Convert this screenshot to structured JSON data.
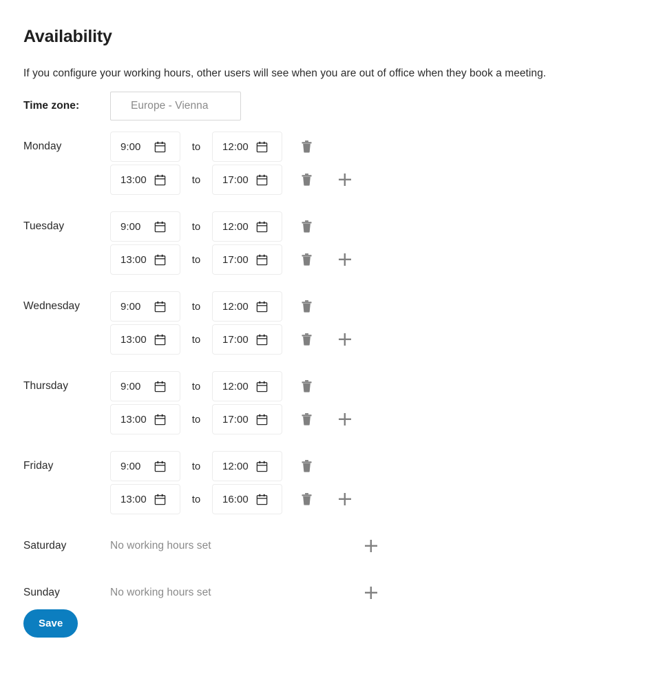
{
  "page": {
    "title": "Availability",
    "intro": "If you configure your working hours, other users will see when you are out of office when they book a meeting.",
    "timezone_label": "Time zone:",
    "timezone_value": "Europe - Vienna",
    "to_label": "to",
    "empty_text": "No working hours set",
    "save_label": "Save"
  },
  "colors": {
    "accent": "#0c7ec0",
    "text": "#2b2b2b",
    "heading": "#1f1f1f",
    "muted": "#8a8a8a",
    "field_border": "#ececec",
    "tz_border": "#d6d6d6",
    "icon_dark": "#2b2b2b",
    "icon_gray": "#808080"
  },
  "icons": {
    "calendar": "calendar-icon",
    "trash": "trash-icon",
    "plus": "plus-icon"
  },
  "days": [
    {
      "label": "Monday",
      "slots": [
        {
          "start": "9:00",
          "end": "12:00"
        },
        {
          "start": "13:00",
          "end": "17:00"
        }
      ]
    },
    {
      "label": "Tuesday",
      "slots": [
        {
          "start": "9:00",
          "end": "12:00"
        },
        {
          "start": "13:00",
          "end": "17:00"
        }
      ]
    },
    {
      "label": "Wednesday",
      "slots": [
        {
          "start": "9:00",
          "end": "12:00"
        },
        {
          "start": "13:00",
          "end": "17:00"
        }
      ]
    },
    {
      "label": "Thursday",
      "slots": [
        {
          "start": "9:00",
          "end": "12:00"
        },
        {
          "start": "13:00",
          "end": "17:00"
        }
      ]
    },
    {
      "label": "Friday",
      "slots": [
        {
          "start": "9:00",
          "end": "12:00"
        },
        {
          "start": "13:00",
          "end": "16:00"
        }
      ]
    },
    {
      "label": "Saturday",
      "slots": []
    },
    {
      "label": "Sunday",
      "slots": []
    }
  ]
}
